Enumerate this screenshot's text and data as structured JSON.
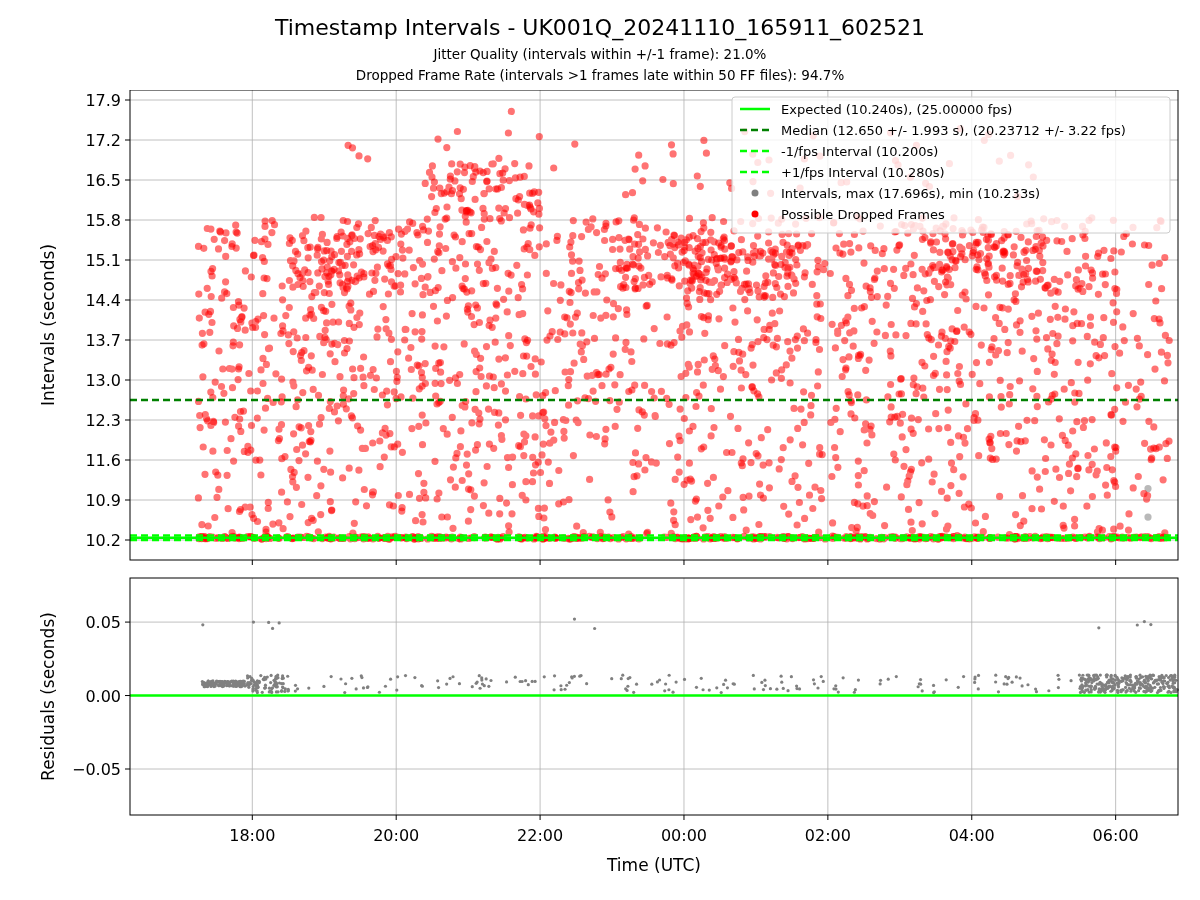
{
  "title": "Timestamp Intervals - UK001Q_20241110_165911_602521",
  "subtitles": [
    "Jitter Quality (intervals within +/-1 frame): 21.0%",
    "Dropped Frame Rate (intervals >1 frames late within 50 FF files): 94.7%"
  ],
  "intervals_plot": {
    "chart_data": {
      "type": "line",
      "ylabel": "Intervals (seconds)",
      "grid": true,
      "legend": "upper right",
      "x": [
        "2024-11-10T16:18",
        "2024-11-11T06:52"
      ],
      "xlim": [
        "2024-11-10T16:18",
        "2024-11-11T06:52"
      ],
      "ylim": [
        9.85,
        18.075
      ],
      "yticks": [
        {
          "value": 10.2,
          "label": "10.2"
        },
        {
          "value": 10.9,
          "label": "10.9"
        },
        {
          "value": 11.6,
          "label": "11.6"
        },
        {
          "value": 12.3,
          "label": "12.3"
        },
        {
          "value": 13.0,
          "label": "13.0"
        },
        {
          "value": 13.7,
          "label": "13.7"
        },
        {
          "value": 14.4,
          "label": "14.4"
        },
        {
          "value": 15.1,
          "label": "15.1"
        },
        {
          "value": 15.8,
          "label": "15.8"
        },
        {
          "value": 16.5,
          "label": "16.5"
        },
        {
          "value": 17.2,
          "label": "17.2"
        },
        {
          "value": 17.9,
          "label": "17.9"
        }
      ],
      "series": [
        {
          "name": "Expected (10.240s), (25.00000 fps)",
          "color": "#00ff00",
          "line_style": "solid",
          "values": [
            10.24,
            10.24
          ]
        },
        {
          "name": "Median (12.650 +/- 1.993 s), (20.23712 +/- 3.22 fps)",
          "color": "#008000",
          "line_style": "dashed",
          "values": [
            12.65,
            12.65
          ]
        },
        {
          "name": "-1/fps Interval (10.200s)",
          "color": "#00ff00",
          "line_style": "dashed",
          "values": [
            10.2,
            10.2
          ]
        },
        {
          "name": "+1/fps Interval (10.280s)",
          "color": "#00ff00",
          "line_style": "dashed",
          "values": [
            10.28,
            10.28
          ]
        }
      ]
    },
    "point_legend": [
      {
        "label": "Intervals, max (17.696s), min (10.233s)",
        "color": "#808080"
      },
      {
        "label": "Possible Dropped Frames",
        "color": "#ff0000"
      }
    ]
  },
  "residuals_plot": {
    "chart_data": {
      "type": "line",
      "xlabel": "Time (UTC)",
      "ylabel": "Residuals (seconds)",
      "grid": true,
      "x": [
        "2024-11-10T16:18",
        "2024-11-11T06:52"
      ],
      "xlim": [
        "2024-11-10T16:18",
        "2024-11-11T06:52"
      ],
      "ylim": [
        -0.0813,
        0.08
      ],
      "xticks": [
        {
          "value": "2024-11-10T18:00",
          "label": "18:00"
        },
        {
          "value": "2024-11-10T20:00",
          "label": "20:00"
        },
        {
          "value": "2024-11-10T22:00",
          "label": "22:00"
        },
        {
          "value": "2024-11-11T00:00",
          "label": "00:00"
        },
        {
          "value": "2024-11-11T02:00",
          "label": "02:00"
        },
        {
          "value": "2024-11-11T04:00",
          "label": "04:00"
        },
        {
          "value": "2024-11-11T06:00",
          "label": "06:00"
        }
      ],
      "yticks": [
        {
          "value": 0.05,
          "label": "0.05"
        },
        {
          "value": 0,
          "label": "0.00"
        },
        {
          "value": -0.05,
          "label": "−0.05"
        }
      ],
      "series": [
        {
          "color": "#00ff00",
          "line_style": "solid",
          "values": [
            0,
            0
          ]
        }
      ]
    }
  }
}
